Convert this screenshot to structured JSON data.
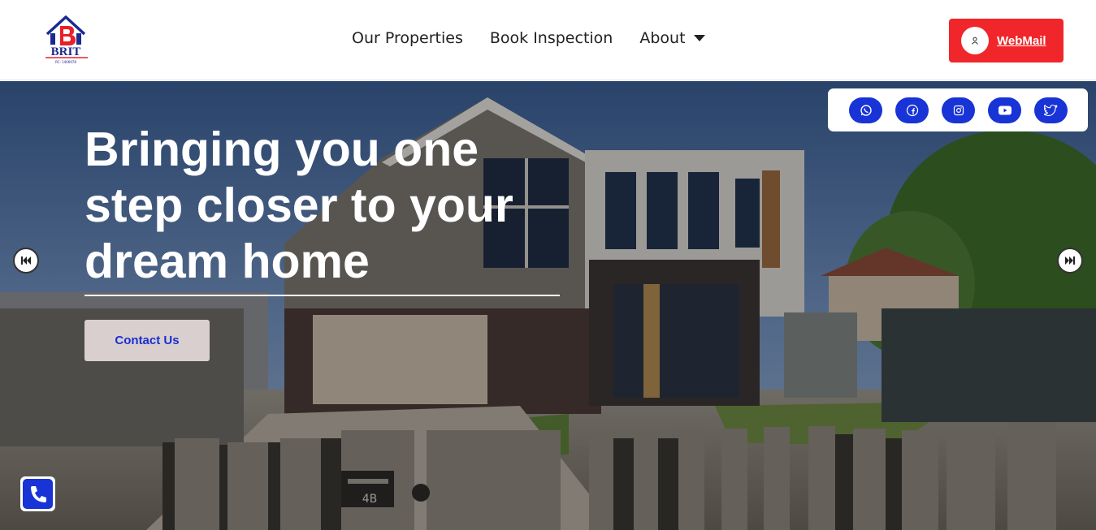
{
  "header": {
    "logo": {
      "text": "BRIT",
      "subtext": "RC: 1406978",
      "icon": "house-logo-icon",
      "colors": {
        "red": "#e8202a",
        "blue": "#1a2a8f"
      }
    },
    "nav": {
      "items": [
        {
          "label": "Our Properties"
        },
        {
          "label": "Book Inspection"
        },
        {
          "label": "About",
          "icon": "caret-down-icon"
        }
      ]
    },
    "webmail": {
      "label": "WebMail",
      "icon": "user-icon",
      "color": "#f0262a"
    }
  },
  "hero": {
    "headline": "Bringing you one step closer to your dream home",
    "contact_button": {
      "label": "Contact Us",
      "text_color": "#1a2fd0"
    },
    "social": [
      {
        "name": "whatsapp-icon"
      },
      {
        "name": "facebook-icon"
      },
      {
        "name": "instagram-icon"
      },
      {
        "name": "youtube-icon"
      },
      {
        "name": "twitter-icon"
      }
    ],
    "social_color": "#1833d6",
    "nav_prev_icon": "skip-back-icon",
    "nav_next_icon": "skip-forward-icon",
    "house_number": "4B"
  },
  "floating": {
    "phone_icon": "phone-icon"
  }
}
